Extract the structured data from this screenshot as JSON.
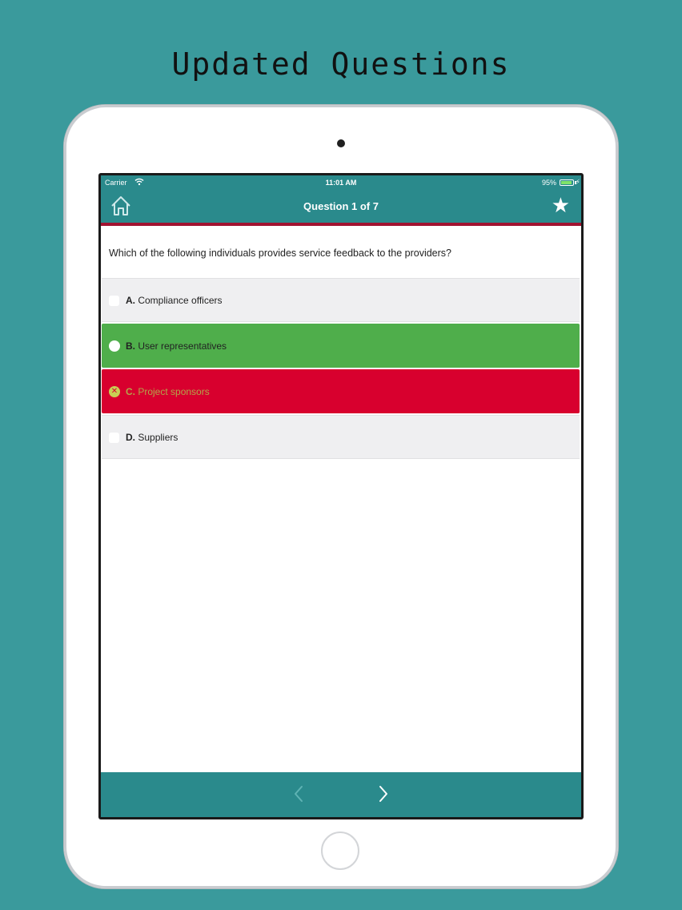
{
  "headline": "Updated Questions",
  "statusbar": {
    "carrier": "Carrier",
    "time": "11:01 AM",
    "battery": "95%",
    "battery_level": 0.95
  },
  "nav": {
    "title": "Question 1 of 7",
    "home_icon": "home-icon",
    "star_icon": "star-icon"
  },
  "question": {
    "text": "Which of the following individuals provides service feedback to the providers?"
  },
  "answers": [
    {
      "letter": "A.",
      "text": "Compliance officers",
      "state": "neutral"
    },
    {
      "letter": "B.",
      "text": "User representatives",
      "state": "correct"
    },
    {
      "letter": "C.",
      "text": "Project sponsors",
      "state": "wrong"
    },
    {
      "letter": "D.",
      "text": "Suppliers",
      "state": "neutral"
    }
  ],
  "toolbar": {
    "prev_icon": "chevron-left-icon",
    "next_icon": "chevron-right-icon"
  },
  "colors": {
    "background": "#3a9a9c",
    "bar": "#2a8a8c",
    "accent": "#a11230",
    "correct": "#4fae4b",
    "wrong": "#d8002e"
  }
}
